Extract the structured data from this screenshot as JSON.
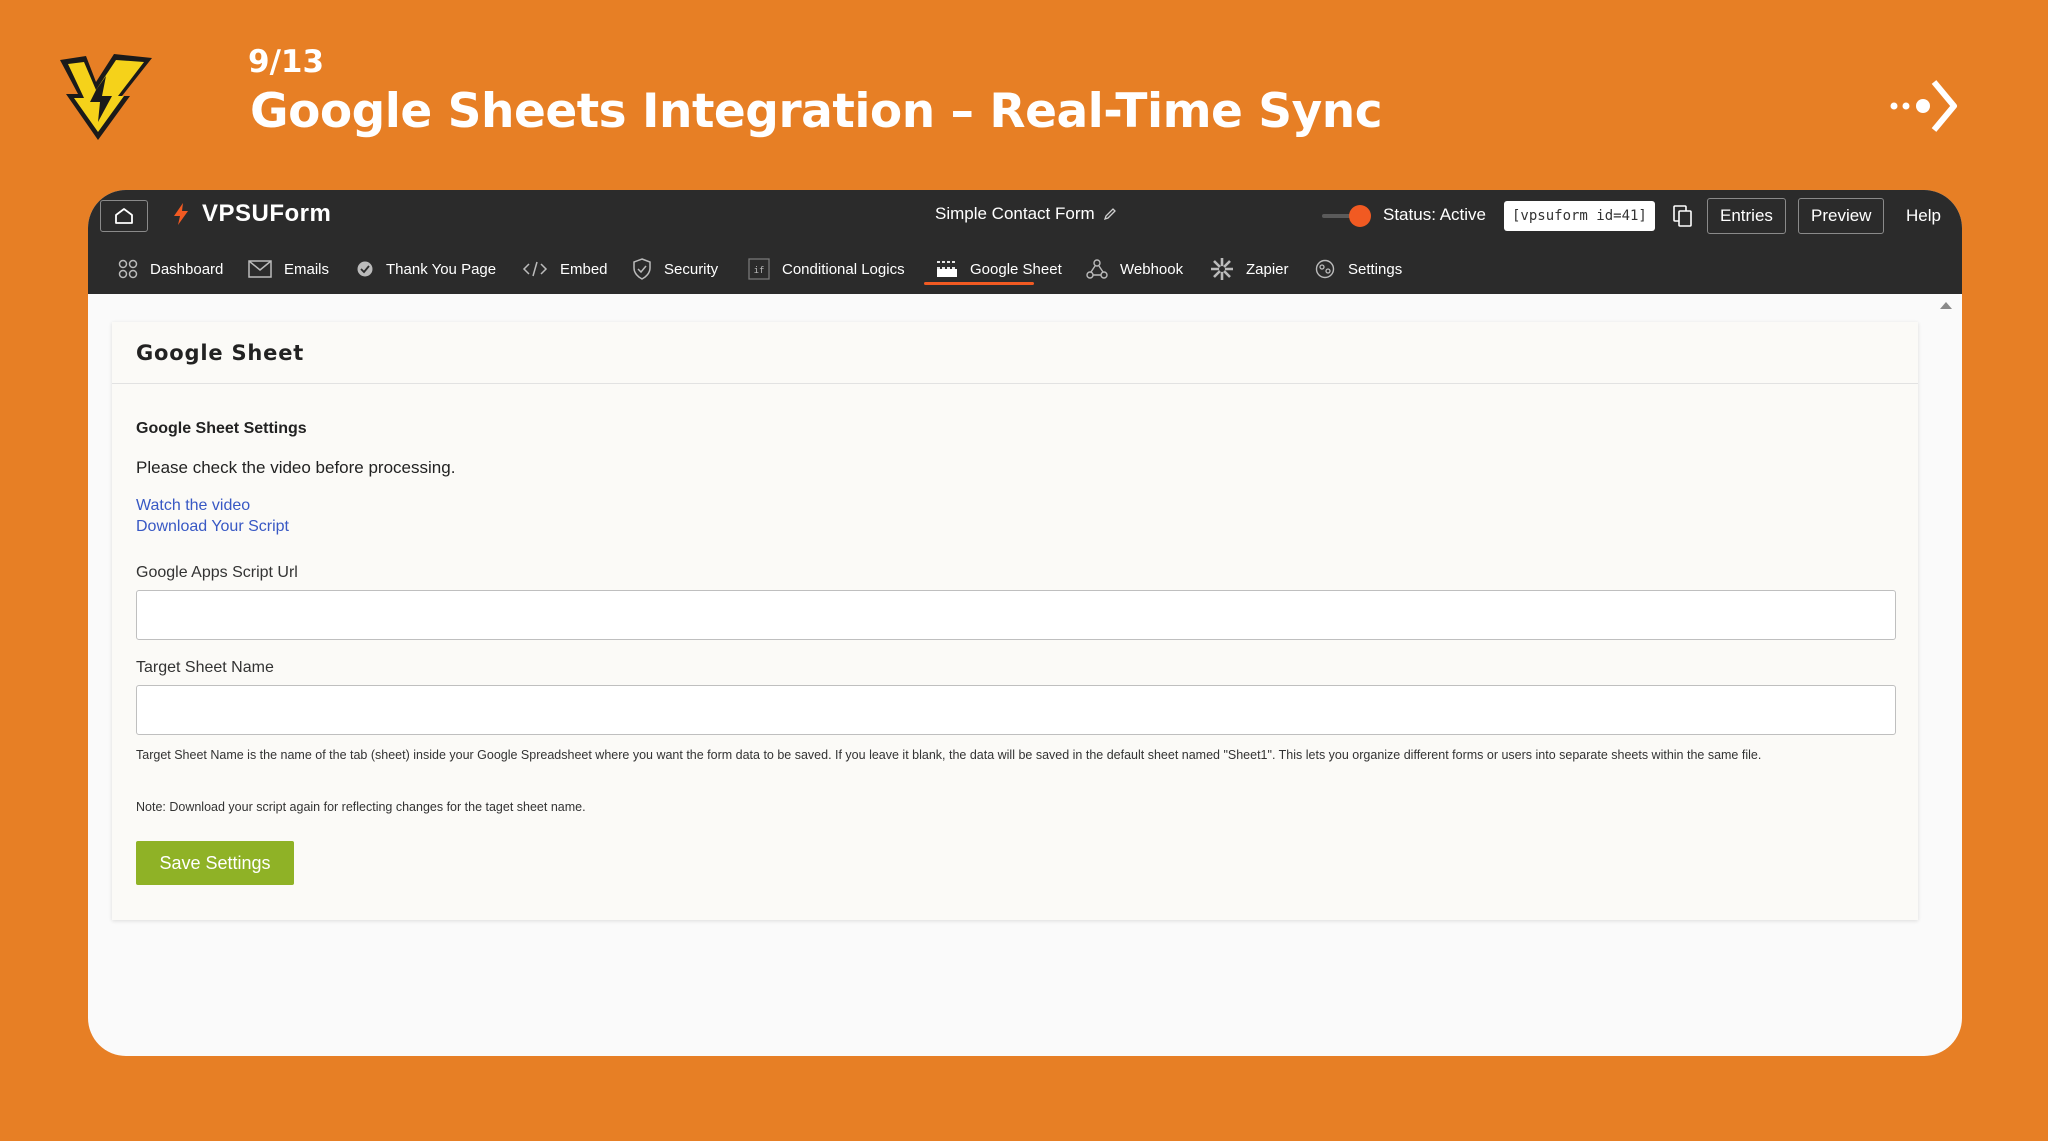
{
  "slide": {
    "counter": "9/13",
    "title": "Google Sheets Integration – Real-Time Sync",
    "logo_icon": "lightning-shield-logo",
    "next_icon": "dotted-arrow-right-icon"
  },
  "colors": {
    "background": "#E77F25",
    "topbar": "#2b2b2b",
    "accent": "#f15a22",
    "save_button": "#8fb226",
    "link": "#3858c4"
  },
  "topbar": {
    "home_icon": "home-icon",
    "brand_icon": "bolt-icon",
    "brand_name": "VPSUForm",
    "form_title": "Simple Contact Form",
    "edit_icon": "pencil-icon",
    "status_text": "Status: Active",
    "shortcode": "[vpsuform id=41]",
    "copy_icon": "copy-icon",
    "entries_label": "Entries",
    "preview_label": "Preview",
    "help_label": "Help"
  },
  "nav": {
    "active": "Google Sheet",
    "items": [
      {
        "label": "Dashboard",
        "icon": "dashboard-icon"
      },
      {
        "label": "Emails",
        "icon": "envelope-icon"
      },
      {
        "label": "Thank You Page",
        "icon": "check-badge-icon"
      },
      {
        "label": "Embed",
        "icon": "code-icon"
      },
      {
        "label": "Security",
        "icon": "shield-check-icon"
      },
      {
        "label": "Conditional Logics",
        "icon": "if-icon"
      },
      {
        "label": "Google Sheet",
        "icon": "sheet-icon"
      },
      {
        "label": "Webhook",
        "icon": "webhook-icon"
      },
      {
        "label": "Zapier",
        "icon": "zapier-icon"
      },
      {
        "label": "Settings",
        "icon": "settings-icon"
      }
    ]
  },
  "card": {
    "title": "Google Sheet",
    "section_title": "Google Sheet Settings",
    "intro": "Please check the video before processing.",
    "link_video": "Watch the video",
    "link_script": "Download Your Script",
    "url_label": "Google Apps Script Url",
    "url_value": "",
    "sheet_label": "Target Sheet Name",
    "sheet_value": "",
    "help_text": "Target Sheet Name is the name of the tab (sheet) inside your Google Spreadsheet where you want the form data to be saved. If you leave it blank, the data will be saved in the default sheet named \"Sheet1\". This lets you organize different forms or users into separate sheets within the same file.",
    "note": "Note: Download your script again for reflecting changes for the taget sheet name.",
    "save_label": "Save Settings"
  }
}
